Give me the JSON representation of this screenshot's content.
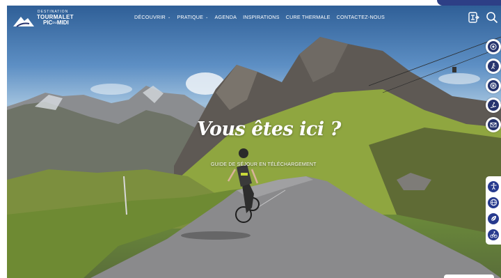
{
  "brand": {
    "line1": "DESTINATION",
    "line2": "TOURMALET",
    "line3": "PIC",
    "line3_small": "DU",
    "line4": "MIDI"
  },
  "nav": [
    {
      "label": "DÉCOUVRIR",
      "dropdown": true
    },
    {
      "label": "PRATIQUE",
      "dropdown": true
    },
    {
      "label": "AGENDA",
      "dropdown": false
    },
    {
      "label": "INSPIRATIONS",
      "dropdown": false
    },
    {
      "label": "CURE THERMALE",
      "dropdown": false
    },
    {
      "label": "CONTACTEZ-NOUS",
      "dropdown": false
    }
  ],
  "hero": {
    "title": "Vous êtes ici ?",
    "subtitle": "GUIDE DE SÉJOUR EN TÉLÉCHARGEMENT"
  },
  "icons": {
    "top": [
      "translate-icon",
      "search-icon"
    ],
    "side": [
      "target-icon",
      "hiker-icon",
      "bike-wheel-icon",
      "skier-icon",
      "mail-icon"
    ],
    "accessibility": [
      "accessibility-icon",
      "globe-icon",
      "leaf-icon",
      "cyclist-icon"
    ]
  },
  "colors": {
    "navy": "#27346e",
    "accent_blue": "#2d3f86"
  }
}
